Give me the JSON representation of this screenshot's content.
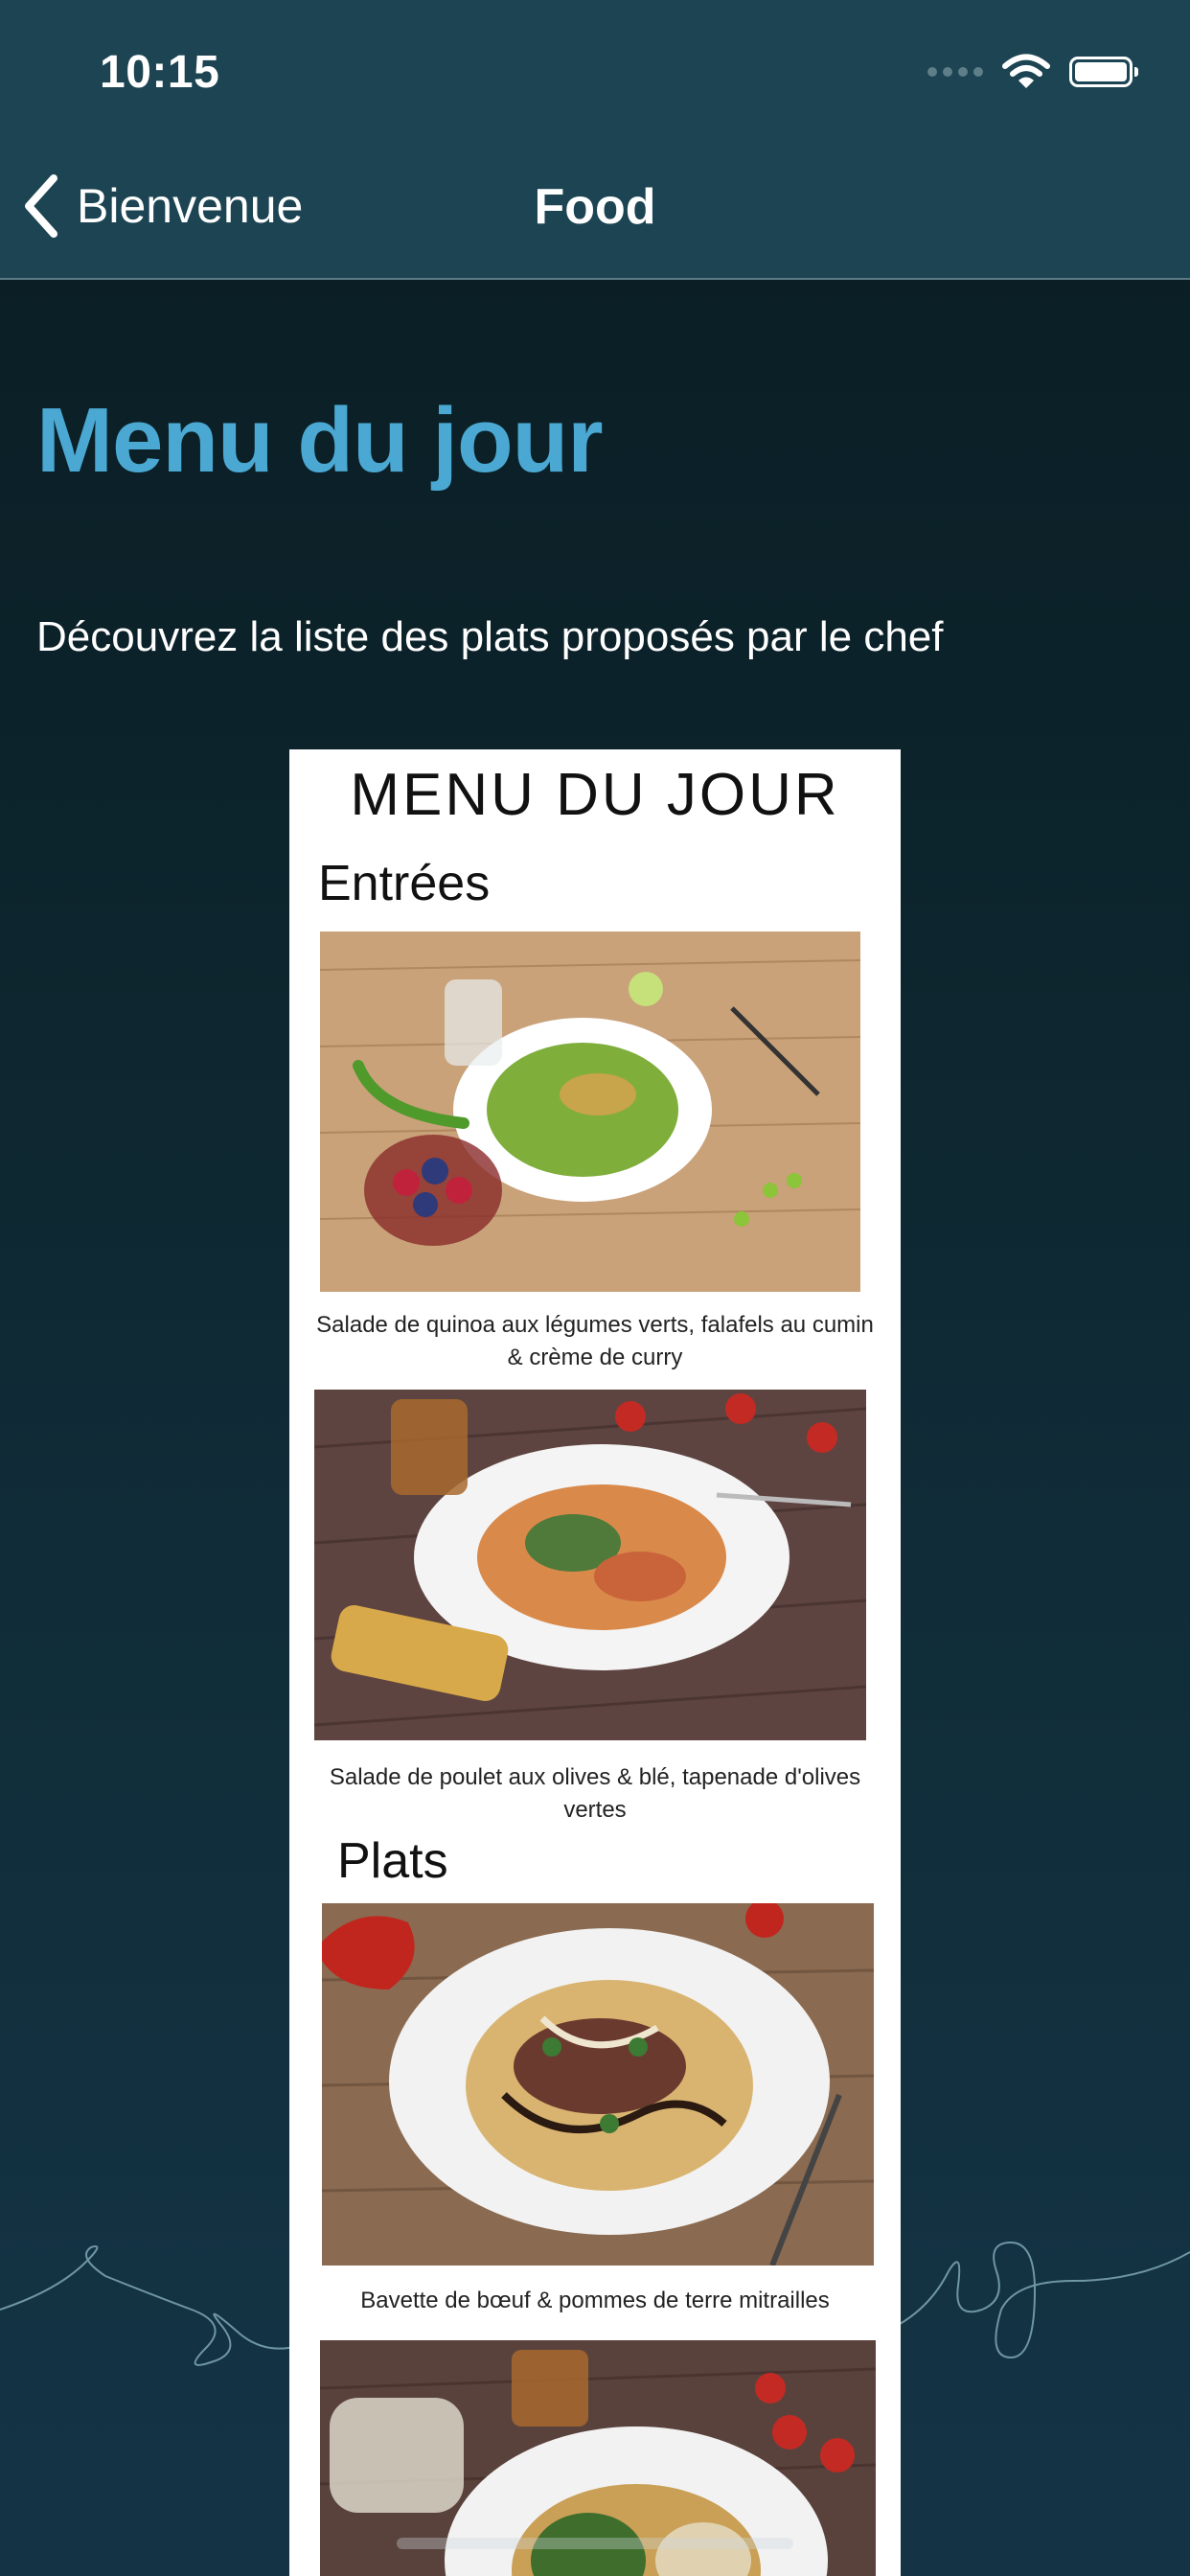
{
  "status_bar": {
    "time": "10:15"
  },
  "nav": {
    "back_label": "Bienvenue",
    "title": "Food"
  },
  "content": {
    "heading": "Menu du jour",
    "subtitle": "Découvrez la liste des plats proposés par le chef"
  },
  "menu_image": {
    "title": "MENU DU JOUR",
    "section_entrees": "Entrées",
    "section_plats": "Plats",
    "items": [
      {
        "caption": "Salade de quinoa aux légumes verts, falafels au cumin & crème de curry"
      },
      {
        "caption": "Salade de poulet aux olives & blé, tapenade d'olives vertes"
      },
      {
        "caption": "Bavette de bœuf & pommes de terre mitrailles"
      }
    ]
  },
  "colors": {
    "nav_bar": "#1c4453",
    "background": "#0c232b",
    "heading": "#4aa8d2"
  },
  "icons": [
    "chevron-left-icon",
    "wifi-icon",
    "battery-icon",
    "signal-dots-icon"
  ]
}
